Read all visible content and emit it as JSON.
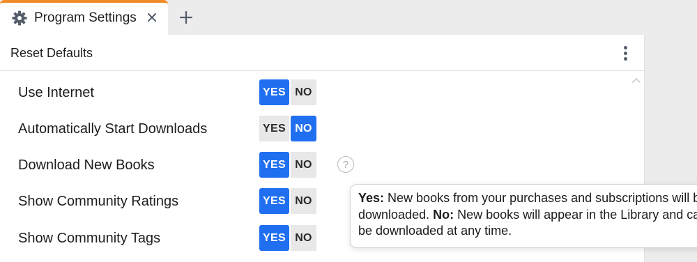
{
  "tabs": [
    {
      "title": "Program Settings",
      "icon": "gear-icon",
      "active": true
    }
  ],
  "new_tab_icon": "plus-icon",
  "toolbar": {
    "reset_label": "Reset Defaults",
    "menu_icon": "kebab-menu-icon"
  },
  "settings": [
    {
      "label": "Use Internet",
      "yes_label": "YES",
      "no_label": "NO",
      "value": "YES"
    },
    {
      "label": "Automatically Start Downloads",
      "yes_label": "YES",
      "no_label": "NO",
      "value": "NO"
    },
    {
      "label": "Download New Books",
      "yes_label": "YES",
      "no_label": "NO",
      "value": "YES",
      "help": "?"
    },
    {
      "label": "Show Community Ratings",
      "yes_label": "YES",
      "no_label": "NO",
      "value": "YES"
    },
    {
      "label": "Show Community Tags",
      "yes_label": "YES",
      "no_label": "NO",
      "value": "YES"
    }
  ],
  "tooltip": {
    "yes_prefix": "Yes:",
    "yes_text": " New books from your purchases and subscriptions will be downloaded. ",
    "no_prefix": "No:",
    "no_text": " New books will appear in the Library and can be downloaded at any time."
  },
  "colors": {
    "accent": "#1f6ff0",
    "tab_indicator": "#f08c28",
    "toggle_off": "#e8e8e8"
  }
}
